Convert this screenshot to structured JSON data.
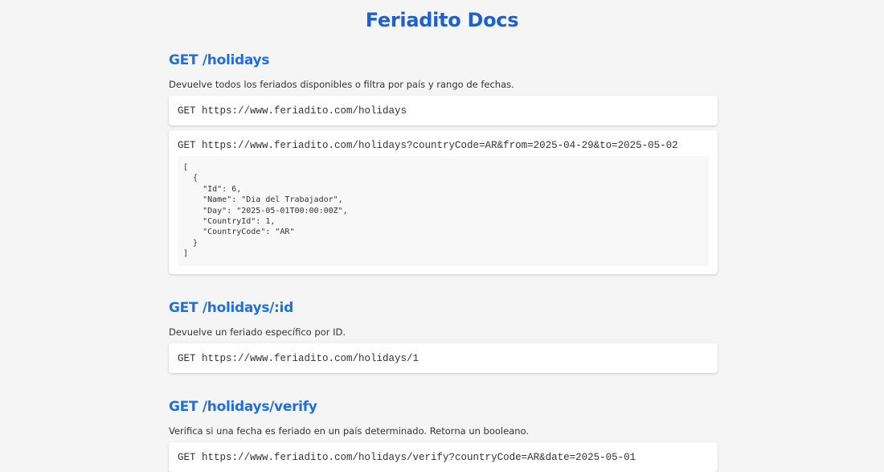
{
  "page": {
    "title": "Feriadito Docs"
  },
  "sections": [
    {
      "heading": "GET /holidays",
      "description": "Devuelve todos los feriados disponibles o filtra por país y rango de fechas.",
      "requests": [
        {
          "line": "GET https://www.feriadito.com/holidays"
        },
        {
          "line": "GET https://www.feriadito.com/holidays?countryCode=AR&from=2025-04-29&to=2025-05-02",
          "response_lines": [
            "[",
            "  {",
            "    \"Id\": 6,",
            "    \"Name\": \"Dia del Trabajador\",",
            "    \"Day\": \"2025-05-01T00:00:00Z\",",
            "    \"CountryId\": 1,",
            "    \"CountryCode\": \"AR\"",
            "  }",
            "]"
          ]
        }
      ]
    },
    {
      "heading": "GET /holidays/:id",
      "description": "Devuelve un feriado específico por ID.",
      "requests": [
        {
          "line": "GET https://www.feriadito.com/holidays/1"
        }
      ]
    },
    {
      "heading": "GET /holidays/verify",
      "description": "Verifica si una fecha es feriado en un país determinado. Retorna un booleano.",
      "requests": [
        {
          "line": "GET https://www.feriadito.com/holidays/verify?countryCode=AR&date=2025-05-01"
        }
      ]
    }
  ],
  "colors": {
    "title": "#1f5fd0",
    "heading": "#1f6fe0",
    "background": "#f5f5f6",
    "card": "#ffffff",
    "code_background": "#f8f8f9"
  }
}
